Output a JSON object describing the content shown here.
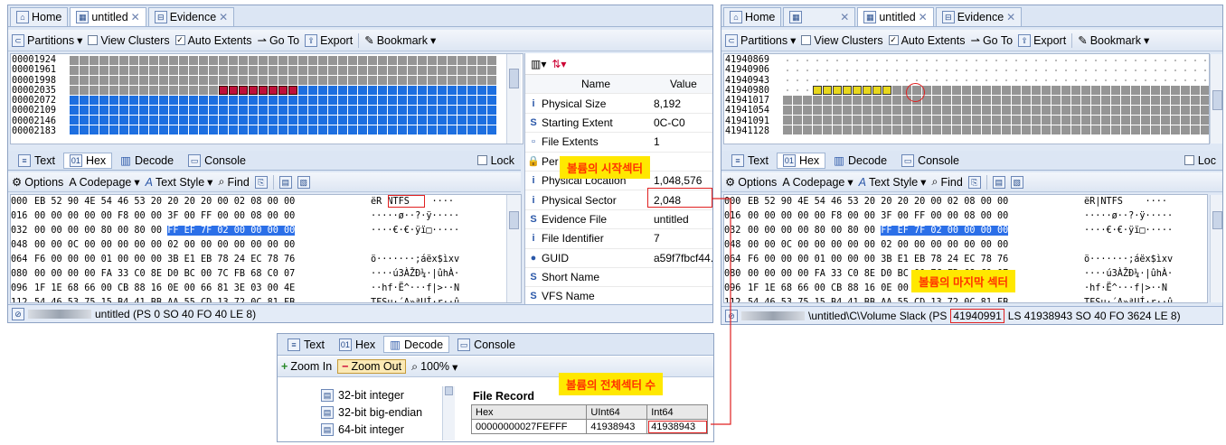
{
  "left_window": {
    "tabs": [
      {
        "label": "Home"
      },
      {
        "label": "untitled"
      },
      {
        "label": "Evidence"
      }
    ],
    "toolbar": {
      "partitions": "Partitions",
      "view_clusters": "View Clusters",
      "auto_extents": "Auto Extents",
      "goto": "Go To",
      "export": "Export",
      "bookmark": "Bookmark"
    },
    "map_offsets": [
      "00001924",
      "00001961",
      "00001998",
      "00002035",
      "00002072",
      "00002109",
      "00002146",
      "00002183"
    ],
    "view_tabs": {
      "text": "Text",
      "hex": "Hex",
      "decode": "Decode",
      "console": "Console",
      "lock": "Lock"
    },
    "hex_toolbar": {
      "options": "Options",
      "codepage": "Codepage",
      "text_style": "Text Style",
      "find": "Find"
    },
    "hex_rows": [
      {
        "off": "000",
        "bytes": "EB 52 90 4E 54 46 53 20 20 20 20 00 02 08 00 00",
        "ascii": "ëR NTFS    ····"
      },
      {
        "off": "016",
        "bytes": "00 00 00 00 00 F8 00 00 3F 00 FF 00 00 08 00 00",
        "ascii": "·····ø··?·ÿ·····"
      },
      {
        "off": "032",
        "bytes": "00 00 00 00 80 00 80 00 FF EF 7F 02 00 00 00 00",
        "ascii": "····€·€·ÿï□·····"
      },
      {
        "off": "048",
        "bytes": "00 00 0C 00 00 00 00 00 02 00 00 00 00 00 00 00",
        "ascii": ""
      },
      {
        "off": "064",
        "bytes": "F6 00 00 00 01 00 00 00 3B E1 EB 78 24 EC 78 76",
        "ascii": "ö·······;áëx$ìxv"
      },
      {
        "off": "080",
        "bytes": "00 00 00 00 FA 33 C0 8E D0 BC 00 7C FB 68 C0 07",
        "ascii": "····ú3ÀŽÐ¼·|ûhÀ·"
      },
      {
        "off": "096",
        "bytes": "1F 1E 68 66 00 CB 88 16 0E 00 66 81 3E 03 00 4E",
        "ascii": "··hf·Ë^···f|>··N"
      },
      {
        "off": "112",
        "bytes": "54 46 53 75 15 B4 41 BB AA 55 CD 13 72 0C 81 FB",
        "ascii": "TFSu·´A»ªUÍ·r··û"
      }
    ],
    "status": "untitled (PS 0 SO 40 FO 40 LE 8)",
    "properties": {
      "header_name": "Name",
      "header_value": "Value",
      "rows": [
        {
          "icon": "i",
          "name": "Physical Size",
          "value": "8,192"
        },
        {
          "icon": "S",
          "name": "Starting Extent",
          "value": "0C-C0"
        },
        {
          "icon": "▫",
          "name": "File Extents",
          "value": "1"
        },
        {
          "icon": "🔒",
          "name": "Per",
          "value": ""
        },
        {
          "icon": "i",
          "name": "Physical Location",
          "value": "1,048,576"
        },
        {
          "icon": "i",
          "name": "Physical Sector",
          "value": "2,048"
        },
        {
          "icon": "S",
          "name": "Evidence File",
          "value": "untitled"
        },
        {
          "icon": "i",
          "name": "File Identifier",
          "value": "7"
        },
        {
          "icon": "●",
          "name": "GUID",
          "value": "a59f7fbcf44."
        },
        {
          "icon": "S",
          "name": "Short Name",
          "value": ""
        },
        {
          "icon": "S",
          "name": "VFS Name",
          "value": ""
        }
      ]
    },
    "callout": "볼륨의 시작섹터"
  },
  "right_window": {
    "tabs": [
      {
        "label": "Home"
      },
      {
        "label": ""
      },
      {
        "label": "untitled"
      },
      {
        "label": "Evidence"
      }
    ],
    "map_offsets": [
      "41940869",
      "41940906",
      "41940943",
      "41940980",
      "41941017",
      "41941054",
      "41941091",
      "41941128"
    ],
    "hex_rows": [
      {
        "off": "000",
        "bytes": "EB 52 90 4E 54 46 53 20 20 20 20 00 02 08 00 00",
        "ascii": "ëR|NTFS    ····"
      },
      {
        "off": "016",
        "bytes": "00 00 00 00 00 F8 00 00 3F 00 FF 00 00 08 00 00",
        "ascii": "·····ø··?·ÿ·····"
      },
      {
        "off": "032",
        "bytes": "00 00 00 00 80 00 80 00 FF EF 7F 02 00 00 00 00",
        "ascii": "····€·€·ÿï□·····"
      },
      {
        "off": "048",
        "bytes": "00 00 0C 00 00 00 00 00 02 00 00 00 00 00 00 00",
        "ascii": ""
      },
      {
        "off": "064",
        "bytes": "F6 00 00 00 01 00 00 00 3B E1 EB 78 24 EC 78 76",
        "ascii": "ö·······;áëx$ìxv"
      },
      {
        "off": "080",
        "bytes": "00 00 00 00 FA 33 C0 8E D0 BC 00 7C FB 68 C0 07",
        "ascii": "····ú3ÀŽÐ¼·|ûhÀ·"
      },
      {
        "off": "096",
        "bytes": "1F 1E 68 66 00 CB 88 16 0E 00 66 81 3E 03 00 4E",
        "ascii": "·hf·Ë^···f|>··N"
      },
      {
        "off": "112",
        "bytes": "54 46 53 75 15 B4 41 BB AA 55 CD 13 72 0C 81 FB",
        "ascii": "TFSu·´A»ªUÍ·r··û"
      }
    ],
    "view_tabs": {
      "lock": "Loc"
    },
    "status_path": "\\untitled\\C\\Volume Slack (PS",
    "status_ps": "41940991",
    "status_rest": "LS 41938943 SO 40 FO 3624 LE 8)",
    "callout": "볼륨의 마지막 섹터"
  },
  "decode_window": {
    "tabs": {
      "text": "Text",
      "hex": "Hex",
      "decode": "Decode",
      "console": "Console"
    },
    "toolbar": {
      "zoom_in": "Zoom In",
      "zoom_out": "Zoom Out",
      "zoom_level": "100%"
    },
    "tree": [
      "32-bit integer",
      "32-bit big-endian",
      "64-bit integer"
    ],
    "record_title": "File Record",
    "table_headers": [
      "Hex",
      "UInt64",
      "Int64"
    ],
    "table_row": [
      "00000000027FEFFF",
      "41938943",
      "41938943"
    ],
    "callout": "볼륨의 전체섹터 수"
  }
}
